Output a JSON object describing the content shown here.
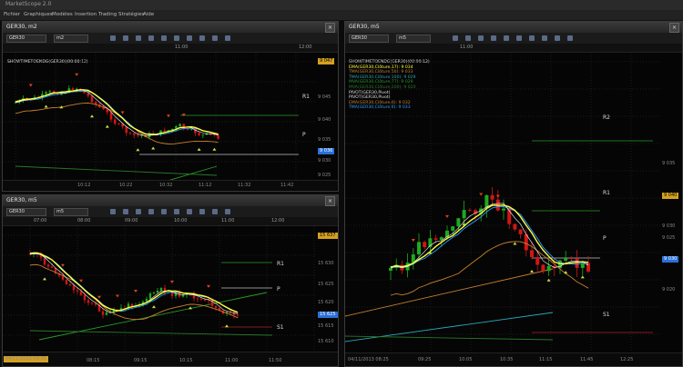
{
  "app": {
    "title": "MarketScope 2.0"
  },
  "menu": [
    "Fichier",
    "Graphiques",
    "Modèles",
    "Insertion",
    "Trading",
    "Stratégies",
    "Aide"
  ],
  "colors": {
    "bull": "#1faa1f",
    "bear": "#d01616",
    "ema": "#ffff40",
    "tma": "#29a0ff",
    "mva1": "#c88030",
    "mva2": "#2a7a2a",
    "mva3": "#2aa6b8",
    "pivot": "#c0c0c0",
    "r1": "#2a9a2a",
    "s1": "#b02020",
    "badge": "#d4a020",
    "blue": "#2a70d8"
  },
  "windows": {
    "topLeft": {
      "title": "GER30, m2",
      "symbol": "GER30",
      "timeframe": "m2",
      "time_labels": [
        "11:00",
        "12:00"
      ],
      "x_labels": [
        "10:12",
        "10:22",
        "10:32",
        "11:12",
        "11:32",
        "11:42"
      ],
      "price_labels": [
        "9 045",
        "9 040",
        "9 035",
        "9 030",
        "9 025"
      ],
      "price_tag": "9 047",
      "blue_tag": "9 036",
      "legend": "SHOWTIMETOENDG(GER30)(00:00:12)",
      "r1": "R1",
      "p": "P"
    },
    "bottomLeft": {
      "title": "GER30, m5",
      "symbol": "GER30",
      "timeframe": "m5",
      "time_labels": [
        "07:00",
        "08:00",
        "09:00",
        "10:00",
        "11:00",
        "12:00"
      ],
      "x_labels": [
        "08:15",
        "09:15",
        "10:15",
        "11:00",
        "11:50"
      ],
      "price_labels": [
        "15 630",
        "15 625",
        "15 620",
        "15 615",
        "15 610"
      ],
      "price_tag": "15 637",
      "blue_tag": "15 625",
      "r1": "R1",
      "p": "P",
      "s1": "S1",
      "date": "04/11/2013 09:35"
    },
    "right": {
      "title": "GER30, m5",
      "symbol": "GER30",
      "timeframe": "m5",
      "time_labels": [
        "11:00"
      ],
      "x_labels": [
        "09:25",
        "10:05",
        "10:35",
        "11:15",
        "11:45",
        "12:25"
      ],
      "price_labels": [
        "9 035",
        "9 030",
        "9 025",
        "9 020"
      ],
      "price_tag": "9 040",
      "blue_tag": "9 030",
      "date": "04/11/2013 08:25",
      "legend": [
        {
          "text": "SHOWTIMETOENDG(GER30)(00:00:12)",
          "color": "#e0e0e0"
        },
        {
          "text": "EMA(GER30,Clôture,17): 9 034",
          "color": "#ffff40"
        },
        {
          "text": "TMA(GER30,Clôture,50): 9 033",
          "color": "#c88030"
        },
        {
          "text": "TMA(GER30,Clôture,100): 9 029",
          "color": "#2aa6b8"
        },
        {
          "text": "MVA(GER30,Clôture,77): 9 029",
          "color": "#2a9a2a"
        },
        {
          "text": "MVA(GER30,Clôture,200): 9 020",
          "color": "#2a7a2a"
        },
        {
          "text": "PIVOT(GER30,Pivot)",
          "color": "#e0e0e0"
        },
        {
          "text": "PIVOT(GER30,Pivot)",
          "color": "#e0e0e0"
        },
        {
          "text": "EMA(GER30,Clôture,6): 9 032",
          "color": "#c88030"
        },
        {
          "text": "TMA(GER30,Clôture,6): 9 033",
          "color": "#29a0ff"
        }
      ],
      "r2": "R2",
      "r1": "R1",
      "p": "P",
      "s1": "S1"
    }
  },
  "icons": [
    "zoom-in-icon",
    "zoom-out-icon",
    "cursor-icon",
    "crosshair-icon",
    "line-icon",
    "hline-icon",
    "fib-icon",
    "text-icon",
    "indicator-icon",
    "settings-icon"
  ]
}
